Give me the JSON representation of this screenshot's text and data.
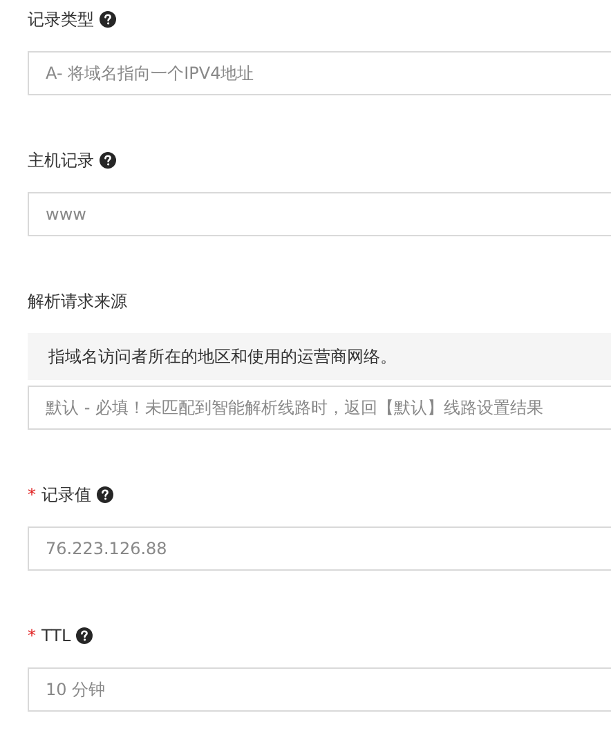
{
  "fields": [
    {
      "label": "记录类型",
      "help": true,
      "value": "A- 将域名指向一个IPV4地址"
    },
    {
      "label": "主机记录",
      "help": true,
      "value": "www"
    },
    {
      "label": "解析请求来源",
      "help": false,
      "note": "指域名访问者所在的地区和使用的运营商网络。",
      "value": "默认 - 必填！未匹配到智能解析线路时，返回【默认】线路设置结果"
    },
    {
      "required_mark": "*",
      "label": "记录值",
      "help": true,
      "value": "76.223.126.88"
    },
    {
      "required_mark": "*",
      "label": "TTL",
      "help": true,
      "value": "10 分钟"
    }
  ]
}
